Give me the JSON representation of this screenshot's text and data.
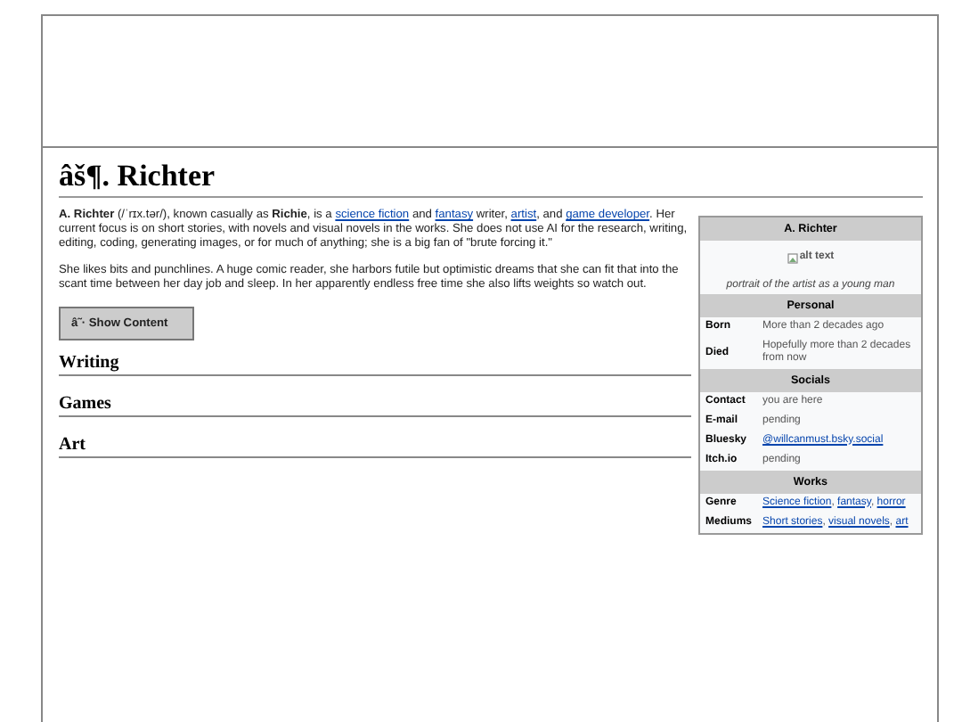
{
  "title": "âš¶. Richter",
  "intro": [
    {
      "kind": "bold",
      "text": "A. Richter"
    },
    {
      "kind": "plain",
      "text": " (/ˈrɪx.tər/), known casually as "
    },
    {
      "kind": "bold",
      "text": "Richie"
    },
    {
      "kind": "plain",
      "text": ", is a "
    },
    {
      "kind": "link",
      "text": "science fiction"
    },
    {
      "kind": "plain",
      "text": " and "
    },
    {
      "kind": "link",
      "text": "fantasy"
    },
    {
      "kind": "plain",
      "text": " writer, "
    },
    {
      "kind": "link",
      "text": "artist"
    },
    {
      "kind": "plain",
      "text": ", and "
    },
    {
      "kind": "link",
      "text": "game developer"
    },
    {
      "kind": "plain",
      "text": ". Her current focus is on short stories, with novels and visual novels in the works. She does not use AI for the research, writing, editing, coding, generating images, or for much of anything; she is a big fan of \"brute forcing it.\""
    }
  ],
  "paragraph": "She likes bits and punchlines. A huge comic reader, she harbors futile but optimistic dreams that she can fit that into the scant time between her day job and sleep. In her apparently endless free time she also lifts weights so watch out.",
  "button": "â˜· Show Content",
  "sections": [
    "Writing",
    "Games",
    "Art"
  ],
  "infobox": {
    "title": "A. Richter",
    "image_alt": "alt text",
    "caption": "portrait of the artist as a young man",
    "groups": [
      {
        "heading": "Personal",
        "rows": [
          {
            "label": "Born",
            "value": [
              {
                "kind": "plain",
                "text": "More than 2 decades ago"
              }
            ]
          },
          {
            "label": "Died",
            "value": [
              {
                "kind": "plain",
                "text": "Hopefully more than 2 decades from now"
              }
            ]
          }
        ]
      },
      {
        "heading": "Socials",
        "rows": [
          {
            "label": "Contact",
            "value": [
              {
                "kind": "plain",
                "text": "you are here"
              }
            ]
          },
          {
            "label": "E-mail",
            "value": [
              {
                "kind": "plain",
                "text": "pending"
              }
            ]
          },
          {
            "label": "Bluesky",
            "value": [
              {
                "kind": "link",
                "text": "@willcanmust.bsky.social"
              }
            ]
          },
          {
            "label": "Itch.io",
            "value": [
              {
                "kind": "plain",
                "text": "pending"
              }
            ]
          }
        ]
      },
      {
        "heading": "Works",
        "rows": [
          {
            "label": "Genre",
            "value": [
              {
                "kind": "link",
                "text": "Science fiction"
              },
              {
                "kind": "plain",
                "text": ", "
              },
              {
                "kind": "link",
                "text": "fantasy"
              },
              {
                "kind": "plain",
                "text": ", "
              },
              {
                "kind": "link",
                "text": "horror"
              }
            ]
          },
          {
            "label": "Mediums",
            "value": [
              {
                "kind": "link",
                "text": "Short stories"
              },
              {
                "kind": "plain",
                "text": ", "
              },
              {
                "kind": "link",
                "text": "visual novels"
              },
              {
                "kind": "plain",
                "text": ", "
              },
              {
                "kind": "link",
                "text": "art"
              }
            ]
          }
        ]
      }
    ]
  }
}
